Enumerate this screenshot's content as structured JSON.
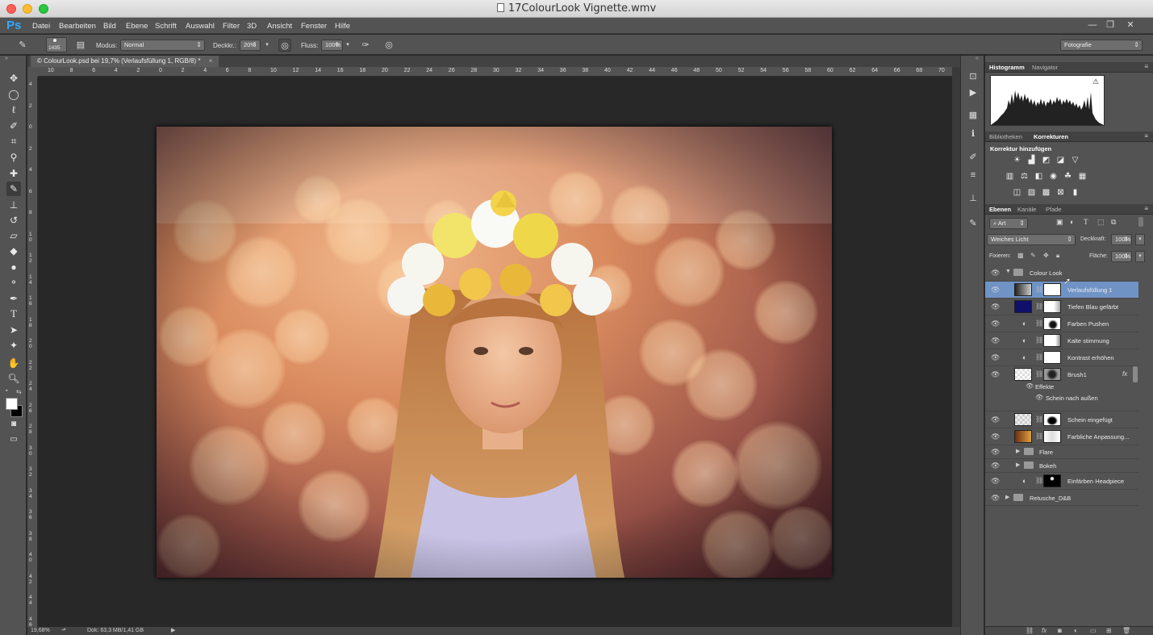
{
  "window": {
    "title": "17ColourLook Vignette.wmv",
    "app_logo": "Ps",
    "colors": {
      "close": "#ff5f57",
      "minimize": "#febc2e",
      "maximize": "#28c840",
      "ps_blue": "#31a8ff",
      "selected_layer": "#7093c6"
    }
  },
  "menu": [
    "Datei",
    "Bearbeiten",
    "Bild",
    "Ebene",
    "Schrift",
    "Auswahl",
    "Filter",
    "3D",
    "Ansicht",
    "Fenster",
    "Hilfe"
  ],
  "window_controls": [
    "—",
    "❐",
    "✕"
  ],
  "options": {
    "brush_size": "1435",
    "modus_label": "Modus:",
    "modus_value": "Normal",
    "deckkr_label": "Deckkr.:",
    "deckkr_value": "20%",
    "fluss_label": "Fluss:",
    "fluss_value": "100%",
    "workspace": "Fotografie"
  },
  "document": {
    "tab_title": "© ColourLook.psd bei 19,7% (Verlaufsfüllung 1, RGB/8) *",
    "tab_close": "×",
    "zoom": "19,68%",
    "doc_info": "Dok: 63,3 MB/1,41 GB",
    "ruler_h": [
      "10",
      "8",
      "6",
      "4",
      "2",
      "0",
      "2",
      "4",
      "6",
      "8",
      "10",
      "12",
      "14",
      "16",
      "18",
      "20",
      "22",
      "24",
      "26",
      "28",
      "30",
      "32",
      "34",
      "36",
      "38",
      "40",
      "42",
      "44",
      "46",
      "48",
      "50",
      "52",
      "54",
      "56",
      "58",
      "60",
      "62",
      "64",
      "66",
      "68",
      "70"
    ],
    "ruler_v": [
      "4",
      "2",
      "0",
      "2",
      "4",
      "6",
      "8",
      "1 0",
      "1 2",
      "1 4",
      "1 6",
      "1 8",
      "2 0",
      "2 2",
      "2 4",
      "2 6",
      "2 8",
      "3 0",
      "3 2",
      "3 4",
      "3 6",
      "3 8",
      "4 0",
      "4 2",
      "4 4",
      "4 6"
    ]
  },
  "histogram": {
    "tabs": [
      "Histogramm",
      "Navigator"
    ],
    "warning_icon": "warning-triangle-icon"
  },
  "adjustments": {
    "tabs": [
      "Bibliotheken",
      "Korrekturen"
    ],
    "heading": "Korrektur hinzufügen"
  },
  "layers": {
    "tabs": [
      "Ebenen",
      "Kanäle",
      "Pfade"
    ],
    "filter": "Art",
    "blend_mode": "Weiches Licht",
    "opacity_label": "Deckkraft:",
    "opacity_value": "100%",
    "lock_label": "Fixieren:",
    "fill_label": "Fläche:",
    "fill_value": "100%",
    "items": [
      {
        "name": "Colour Look",
        "kind": "group-open"
      },
      {
        "name": "Verlaufsfüllung 1",
        "kind": "layer",
        "selected": true
      },
      {
        "name": "Tiefen Blau gefärbt",
        "kind": "layer"
      },
      {
        "name": "Farben Pushen",
        "kind": "layer"
      },
      {
        "name": "Kalte stimmung",
        "kind": "layer"
      },
      {
        "name": "Kontrast erhöhen",
        "kind": "layer"
      },
      {
        "name": "Brush1",
        "kind": "layer",
        "fx": "fx"
      },
      {
        "name": "Effekte",
        "kind": "effects"
      },
      {
        "name": "Schein nach außen",
        "kind": "effect"
      },
      {
        "name": "Schein eingefügt",
        "kind": "layer"
      },
      {
        "name": "Farbliche Anpassung...",
        "kind": "layer"
      },
      {
        "name": "Flare",
        "kind": "group"
      },
      {
        "name": "Bokeh",
        "kind": "group"
      },
      {
        "name": "Einfärben Headpiece",
        "kind": "layer"
      },
      {
        "name": "Retusche_D&B",
        "kind": "group-top"
      }
    ]
  }
}
